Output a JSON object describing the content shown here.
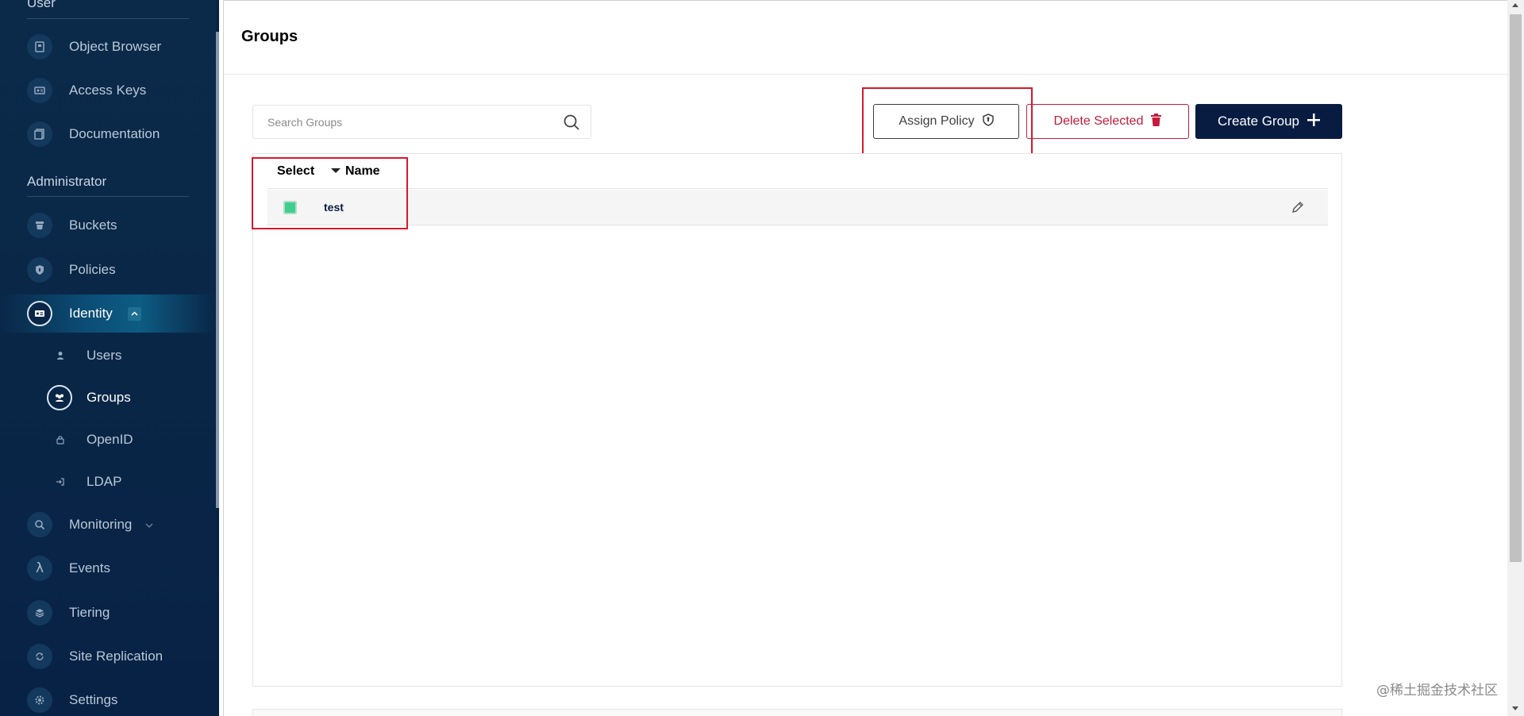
{
  "sidebar": {
    "section_user": "User",
    "user_items": [
      {
        "label": "Object Browser",
        "icon": "object-browser-icon"
      },
      {
        "label": "Access Keys",
        "icon": "access-keys-icon"
      },
      {
        "label": "Documentation",
        "icon": "documentation-icon"
      }
    ],
    "section_admin": "Administrator",
    "admin_items": [
      {
        "label": "Buckets",
        "icon": "buckets-icon"
      },
      {
        "label": "Policies",
        "icon": "policies-icon"
      },
      {
        "label": "Identity",
        "icon": "identity-icon",
        "active": true,
        "expanded": true
      }
    ],
    "identity_sub": [
      {
        "label": "Users",
        "icon": "user-icon"
      },
      {
        "label": "Groups",
        "icon": "groups-icon",
        "active": true
      },
      {
        "label": "OpenID",
        "icon": "lock-icon"
      },
      {
        "label": "LDAP",
        "icon": "login-icon"
      }
    ],
    "other_items": [
      {
        "label": "Monitoring",
        "icon": "monitoring-icon",
        "has_chevron": true
      },
      {
        "label": "Events",
        "icon": "lambda-icon"
      },
      {
        "label": "Tiering",
        "icon": "tiering-icon"
      },
      {
        "label": "Site Replication",
        "icon": "replication-icon"
      },
      {
        "label": "Settings",
        "icon": "gear-icon"
      }
    ]
  },
  "main": {
    "title": "Groups",
    "search_placeholder": "Search Groups",
    "buttons": {
      "assign_policy": "Assign Policy",
      "delete_selected": "Delete Selected",
      "create_group": "Create Group"
    },
    "table": {
      "columns": [
        "Select",
        "Name"
      ],
      "rows": [
        {
          "name": "test",
          "selected": true
        }
      ]
    }
  },
  "watermark": "@稀土掘金技术社区",
  "colors": {
    "sidebar_bg": "#0b2a4a",
    "primary": "#081c42",
    "danger": "#c51b3a",
    "checkbox": "#3ecf8e",
    "highlight_outline": "#d9182e"
  }
}
